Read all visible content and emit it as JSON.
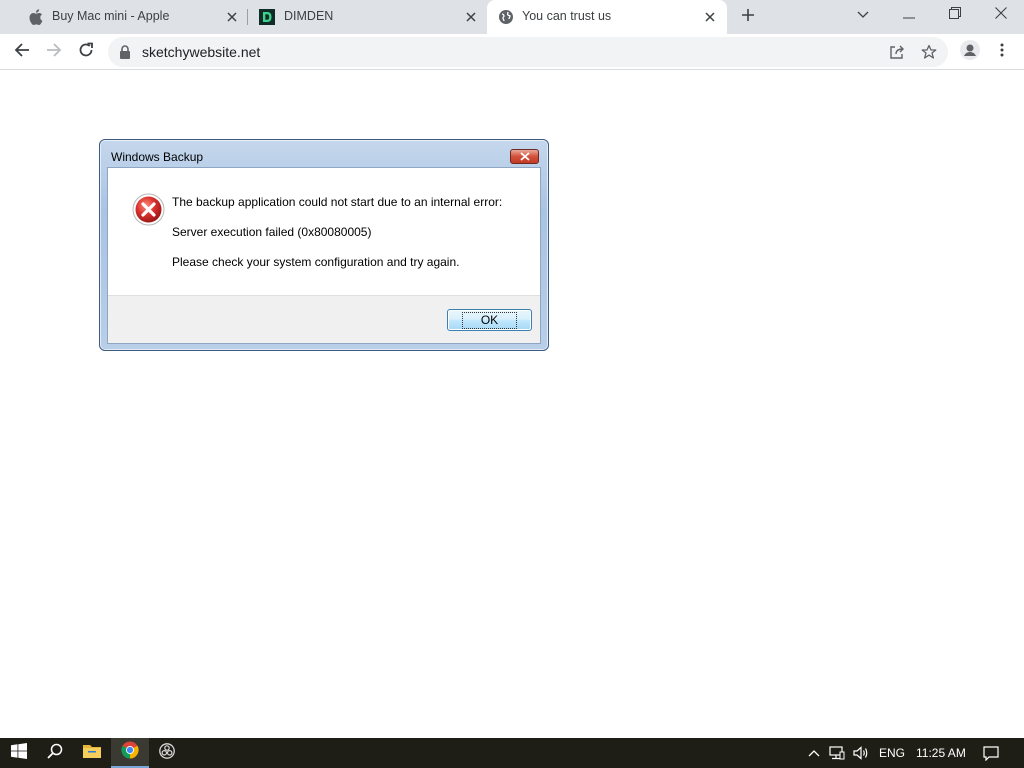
{
  "browser": {
    "tabs": [
      {
        "title": "Buy Mac mini - Apple",
        "icon": "apple-icon",
        "active": false
      },
      {
        "title": "DIMDEN",
        "icon": "dimden-d-icon",
        "active": false
      },
      {
        "title": "You can trust us",
        "icon": "globe-icon",
        "active": true
      }
    ],
    "new_tab_icon": "plus-icon",
    "url": "sketchywebsite.net"
  },
  "dialog": {
    "title": "Windows Backup",
    "icon": "error-icon",
    "message_line1": "The backup application could not start due to an internal error:",
    "message_line2": "Server execution failed (0x80080005)",
    "message_line3": "Please check your system configuration and try again.",
    "ok_label": "OK"
  },
  "taskbar": {
    "language": "ENG",
    "time": "11:25 AM",
    "pinned": [
      "windows-start-icon",
      "search-icon",
      "file-explorer-icon",
      "chrome-icon",
      "obs-icon"
    ]
  },
  "colors": {
    "tabstrip": "#dee1e6",
    "taskbar": "#1f1e16",
    "dialog_frame": "#a9c3e3",
    "error_red": "#c8262b"
  }
}
